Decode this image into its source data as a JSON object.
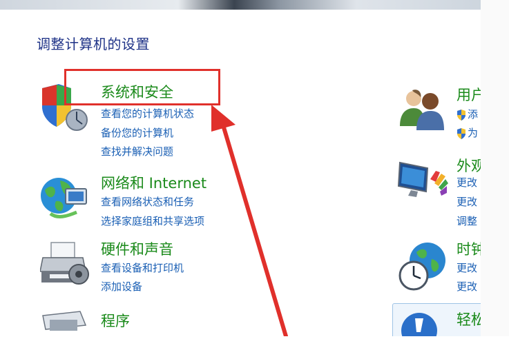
{
  "page_title": "调整计算机的设置",
  "left": [
    {
      "title": "系统和安全",
      "links": [
        "查看您的计算机状态",
        "备份您的计算机",
        "查找并解决问题"
      ]
    },
    {
      "title": "网络和 Internet",
      "links": [
        "查看网络状态和任务",
        "选择家庭组和共享选项"
      ]
    },
    {
      "title": "硬件和声音",
      "links": [
        "查看设备和打印机",
        "添加设备"
      ]
    },
    {
      "title": "程序",
      "links": []
    }
  ],
  "right": [
    {
      "title": "用户",
      "links": [
        "添",
        "为"
      ]
    },
    {
      "title": "外观",
      "links": [
        "更改",
        "更改",
        "调整"
      ]
    },
    {
      "title": "时钟",
      "links": [
        "更改",
        "更改"
      ]
    },
    {
      "title": "轻松",
      "links": []
    }
  ],
  "colors": {
    "title_green": "#1a8a1a",
    "link_blue": "#1a5fb4",
    "annotation_red": "#e0302b",
    "heading_blue": "#1e3287"
  },
  "icons": [
    "security-shield-icon",
    "network-globe-icon",
    "printer-icon",
    "programs-icon",
    "users-icon",
    "monitor-icon",
    "clock-globe-icon",
    "ease-of-access-icon"
  ]
}
